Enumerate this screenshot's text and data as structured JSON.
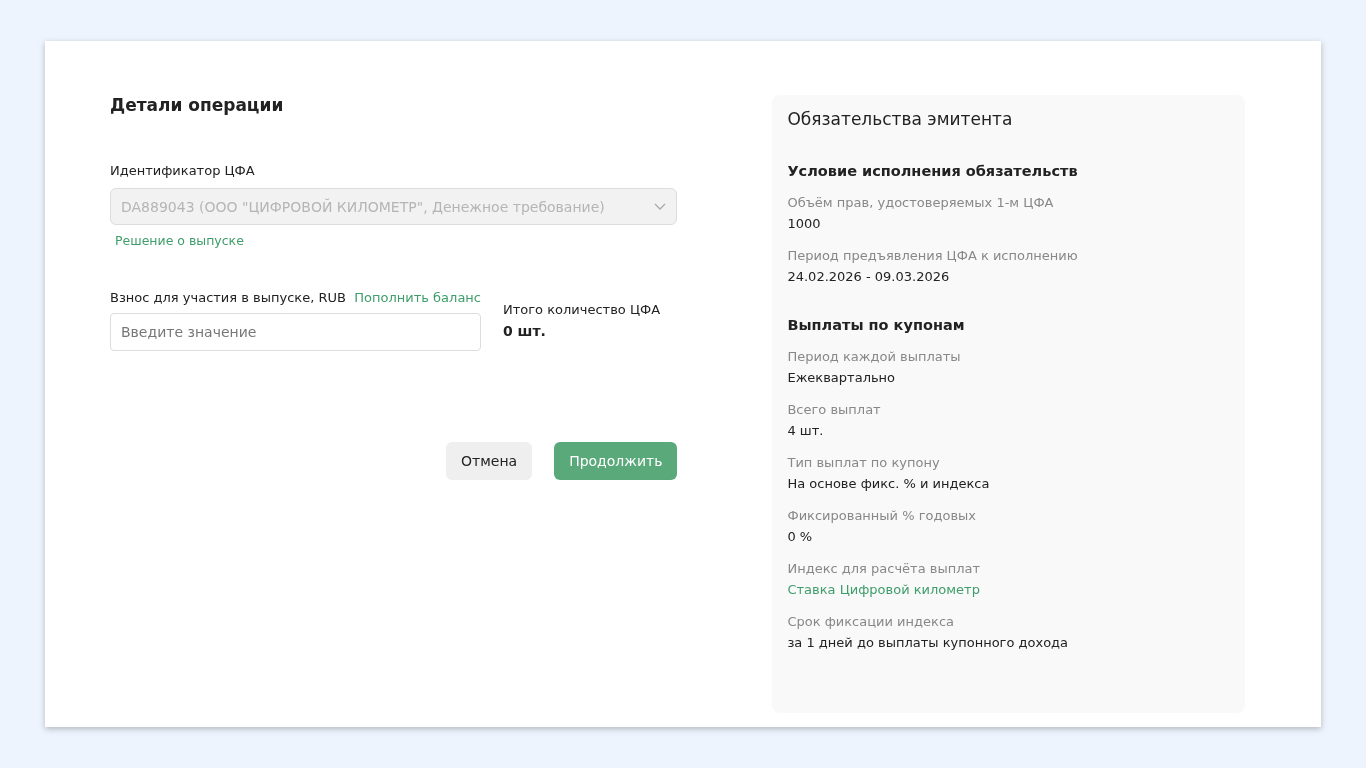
{
  "operation": {
    "title": "Детали операции",
    "identifier": {
      "label": "Идентификатор ЦФА",
      "value": "DA889043 (ООО \"ЦИФРОВОЙ КИЛОМЕТР\", Денежное требование)",
      "disabled": true,
      "link": "Решение о выпуске"
    },
    "contribution": {
      "label": "Взнос для участия в выпуске, RUB",
      "link": "Пополнить баланс",
      "placeholder": "Введите значение"
    },
    "total": {
      "label": "Итого количество ЦФА",
      "value": "0 шт."
    },
    "buttons": [
      {
        "label": "Отмена",
        "kind": "secondary"
      },
      {
        "label": "Продолжить",
        "kind": "primary"
      }
    ]
  },
  "obligations": {
    "title": "Обязательства эмитента",
    "sections": [
      {
        "title": "Условие исполнения обязательств",
        "fields": [
          {
            "label": "Объём прав, удостоверяемых 1-м ЦФА",
            "value": "1000",
            "kind": "text"
          },
          {
            "label": "Период предъявления ЦФА к исполнению",
            "value": "24.02.2026 - 09.03.2026",
            "kind": "text"
          }
        ]
      },
      {
        "title": "Выплаты по купонам",
        "fields": [
          {
            "label": "Период каждой выплаты",
            "value": "Ежеквартально",
            "kind": "text"
          },
          {
            "label": "Всего выплат",
            "value": "4 шт.",
            "kind": "text"
          },
          {
            "label": "Тип выплат по купону",
            "value": "На основе фикс. % и индекса",
            "kind": "text"
          },
          {
            "label": "Фиксированный % годовых",
            "value": "0 %",
            "kind": "text"
          },
          {
            "label": "Индекс для расчёта выплат",
            "value": "Ставка Цифровой километр",
            "kind": "link"
          },
          {
            "label": "Срок фиксации индекса",
            "value": "за 1 дней до выплаты купонного дохода",
            "kind": "text"
          }
        ]
      }
    ]
  }
}
